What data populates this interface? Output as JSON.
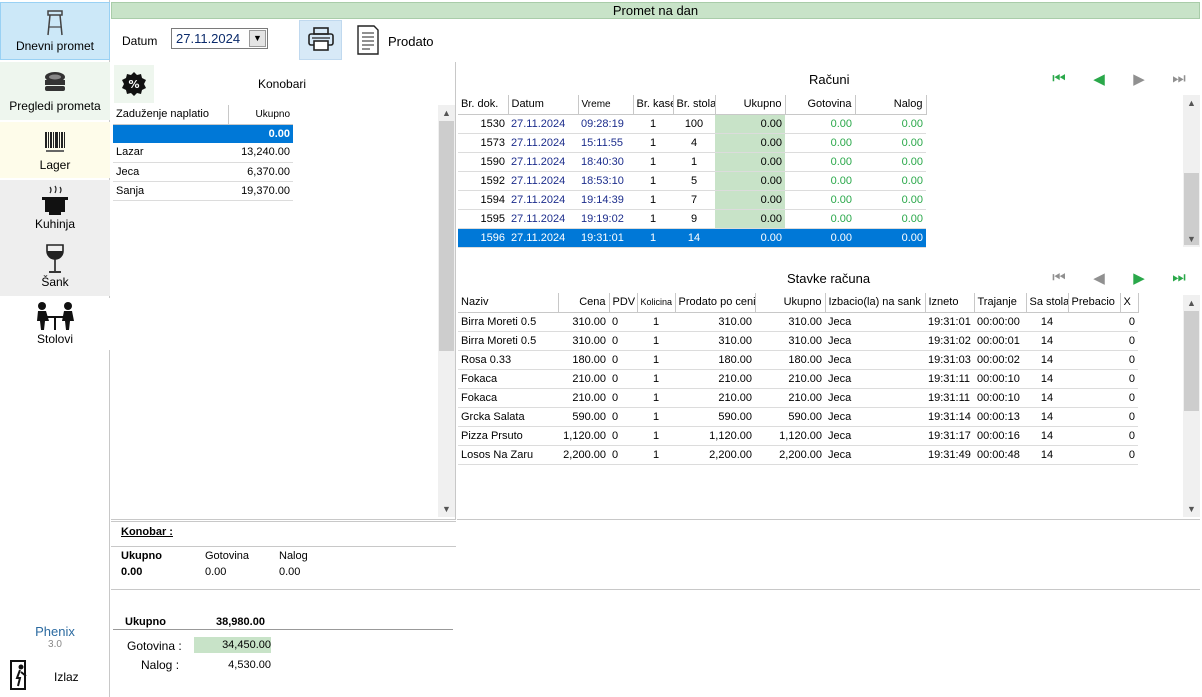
{
  "window": {
    "title": "Promet na dan"
  },
  "sidebar": {
    "items": [
      {
        "label": "Dnevni promet",
        "icon": "bar-stool-icon"
      },
      {
        "label": "Pregledi prometa",
        "icon": "coins-icon"
      },
      {
        "label": "Lager",
        "icon": "barcode-icon"
      },
      {
        "label": "Kuhinja",
        "icon": "cooking-pot-icon"
      },
      {
        "label": "Šank",
        "icon": "wine-glass-icon"
      },
      {
        "label": "Stolovi",
        "icon": "dining-table-icon"
      }
    ],
    "brand": {
      "name": "Phenix",
      "version": "3.0"
    },
    "exit_label": "Izlaz"
  },
  "toolbar": {
    "datum_label": "Datum",
    "datum_value": "27.11.2024",
    "prodato_label": "Prodato"
  },
  "konobari": {
    "title": "Konobari",
    "headers": [
      "Zaduženje naplatio",
      "Ukupno"
    ],
    "selected_value": "0.00",
    "rows": [
      {
        "name": "Lazar",
        "ukupno": "13,240.00"
      },
      {
        "name": "Jeca",
        "ukupno": "6,370.00"
      },
      {
        "name": "Sanja",
        "ukupno": "19,370.00"
      }
    ]
  },
  "racuni": {
    "title": "Računi",
    "headers": [
      "Br. dok.",
      "Datum",
      "Vreme",
      "Br. kase",
      "Br. stola",
      "Ukupno",
      "Gotovina",
      "Nalog"
    ],
    "rows": [
      [
        "1530",
        "27.11.2024",
        "09:28:19",
        "1",
        "100",
        "0.00",
        "0.00",
        "0.00"
      ],
      [
        "1573",
        "27.11.2024",
        "15:11:55",
        "1",
        "4",
        "0.00",
        "0.00",
        "0.00"
      ],
      [
        "1590",
        "27.11.2024",
        "18:40:30",
        "1",
        "1",
        "0.00",
        "0.00",
        "0.00"
      ],
      [
        "1592",
        "27.11.2024",
        "18:53:10",
        "1",
        "5",
        "0.00",
        "0.00",
        "0.00"
      ],
      [
        "1594",
        "27.11.2024",
        "19:14:39",
        "1",
        "7",
        "0.00",
        "0.00",
        "0.00"
      ],
      [
        "1595",
        "27.11.2024",
        "19:19:02",
        "1",
        "9",
        "0.00",
        "0.00",
        "0.00"
      ],
      [
        "1596",
        "27.11.2024",
        "19:31:01",
        "1",
        "14",
        "0.00",
        "0.00",
        "0.00"
      ]
    ],
    "selected_row": 6
  },
  "stavke": {
    "title": "Stavke računa",
    "headers": [
      "Naziv",
      "Cena",
      "PDV",
      "Kolicina",
      "Prodato po ceni",
      "Ukupno",
      "Izbacio(la) na sank",
      "Izneto",
      "Trajanje",
      "Sa stola",
      "Prebacio",
      "X"
    ],
    "rows": [
      [
        "Birra Moreti 0.5",
        "310.00",
        "0",
        "1",
        "310.00",
        "310.00",
        "Jeca",
        "19:31:01",
        "00:00:00",
        "14",
        "",
        "0"
      ],
      [
        "Birra Moreti 0.5",
        "310.00",
        "0",
        "1",
        "310.00",
        "310.00",
        "Jeca",
        "19:31:02",
        "00:00:01",
        "14",
        "",
        "0"
      ],
      [
        "Rosa 0.33",
        "180.00",
        "0",
        "1",
        "180.00",
        "180.00",
        "Jeca",
        "19:31:03",
        "00:00:02",
        "14",
        "",
        "0"
      ],
      [
        "Fokaca",
        "210.00",
        "0",
        "1",
        "210.00",
        "210.00",
        "Jeca",
        "19:31:11",
        "00:00:10",
        "14",
        "",
        "0"
      ],
      [
        "Fokaca",
        "210.00",
        "0",
        "1",
        "210.00",
        "210.00",
        "Jeca",
        "19:31:11",
        "00:00:10",
        "14",
        "",
        "0"
      ],
      [
        "Grcka Salata",
        "590.00",
        "0",
        "1",
        "590.00",
        "590.00",
        "Jeca",
        "19:31:14",
        "00:00:13",
        "14",
        "",
        "0"
      ],
      [
        "Pizza Prsuto",
        "1,120.00",
        "0",
        "1",
        "1,120.00",
        "1,120.00",
        "Jeca",
        "19:31:17",
        "00:00:16",
        "14",
        "",
        "0"
      ],
      [
        "Losos Na Zaru",
        "2,200.00",
        "0",
        "1",
        "2,200.00",
        "2,200.00",
        "Jeca",
        "19:31:49",
        "00:00:48",
        "14",
        "",
        "0"
      ]
    ]
  },
  "konobar_summary": {
    "title": "Konobar :",
    "ukupno_label": "Ukupno",
    "ukupno_value": "0.00",
    "gotovina_label": "Gotovina",
    "gotovina_value": "0.00",
    "nalog_label": "Nalog",
    "nalog_value": "0.00"
  },
  "totals": {
    "ukupno_label": "Ukupno",
    "ukupno_value": "38,980.00",
    "gotovina_label": "Gotovina :",
    "gotovina_value": "34,450.00",
    "nalog_label": "Nalog :",
    "nalog_value": "4,530.00"
  },
  "colors": {
    "selection": "#0078d7",
    "green_cell": "#c8e3c8",
    "nav_green": "#2aa84a",
    "title_bar": "#c8e3c8"
  }
}
